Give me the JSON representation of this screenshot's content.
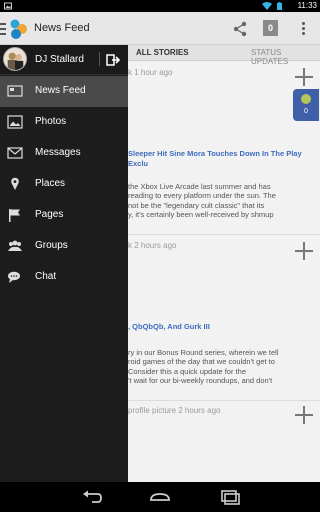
{
  "status_bar": {
    "time": "11:33",
    "icons": [
      "image-icon",
      "wifi-icon",
      "battery-icon"
    ]
  },
  "action_bar": {
    "title": "News Feed",
    "badge": "0"
  },
  "tabs": [
    "All Stories",
    "Status Updates"
  ],
  "feed": {
    "posts": [
      {
        "header": "k 1 hour ago",
        "title": "Sleeper Hit Sine Mora Touches Down In The Play\nExclu",
        "body": "the Xbox Live Arcade last summer and has\nreading to every platform under the sun. The\nnot be the \"legendary cult classic\" that its\ny, it's certainly been well-received by shmup"
      },
      {
        "header": "k 2 hours ago",
        "title": ", QbQbQb, And Gurk III",
        "body": "ry in our Bonus Round series, wherein we tell\nroid games of the day that we couldn't get to\nConsider this a quick update for the\n't wait for our bi-weekly roundups, and don't"
      },
      {
        "header": "profile picture 2 hours ago",
        "title": "",
        "body": ""
      }
    ],
    "widget_count": "0"
  },
  "drawer": {
    "user_name": "DJ Stallard",
    "items": [
      {
        "label": "News Feed",
        "icon": "news-feed-icon",
        "active": true
      },
      {
        "label": "Photos",
        "icon": "photos-icon",
        "active": false
      },
      {
        "label": "Messages",
        "icon": "messages-icon",
        "active": false
      },
      {
        "label": "Places",
        "icon": "places-icon",
        "active": false
      },
      {
        "label": "Pages",
        "icon": "pages-icon",
        "active": false
      },
      {
        "label": "Groups",
        "icon": "groups-icon",
        "active": false
      },
      {
        "label": "Chat",
        "icon": "chat-icon",
        "active": false
      }
    ]
  },
  "nav_bar": {
    "buttons": [
      "back-icon",
      "home-icon",
      "recents-icon"
    ]
  },
  "colors": {
    "drawer_bg": "#1d1d1d",
    "drawer_active": "#4a4a4a",
    "link": "#3d6dbf",
    "widget": "#3f5fa8"
  }
}
